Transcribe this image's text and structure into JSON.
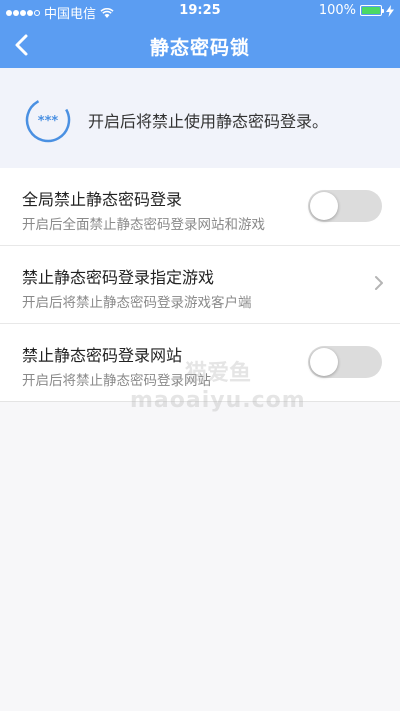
{
  "status_bar": {
    "carrier": "中国电信",
    "time": "19:25",
    "battery_percent": "100%",
    "signal_bars": 4,
    "icons": [
      "signal-icon",
      "wifi-icon",
      "battery-icon",
      "charging-icon"
    ]
  },
  "nav": {
    "title": "静态密码锁",
    "back_icon": "chevron-left-icon"
  },
  "info": {
    "icon": "password-lock-icon",
    "icon_text": "***",
    "text": "开启后将禁止使用静态密码登录。"
  },
  "settings": [
    {
      "title": "全局禁止静态密码登录",
      "subtitle": "开启后全面禁止静态密码登录网站和游戏",
      "control": "toggle",
      "enabled": false
    },
    {
      "title": "禁止静态密码登录指定游戏",
      "subtitle": "开启后将禁止静态密码登录游戏客户端",
      "control": "chevron-right-icon"
    },
    {
      "title": "禁止静态密码登录网站",
      "subtitle": "开启后将禁止静态密码登录网站",
      "control": "toggle",
      "enabled": false
    }
  ],
  "watermark": {
    "cn": "猫爱鱼",
    "en": "maoaiyu.com"
  },
  "colors": {
    "header_bg": "#5b9df2",
    "accent": "#4a90e2",
    "toggle_off": "#dcdcdc",
    "battery": "#4cd964"
  }
}
